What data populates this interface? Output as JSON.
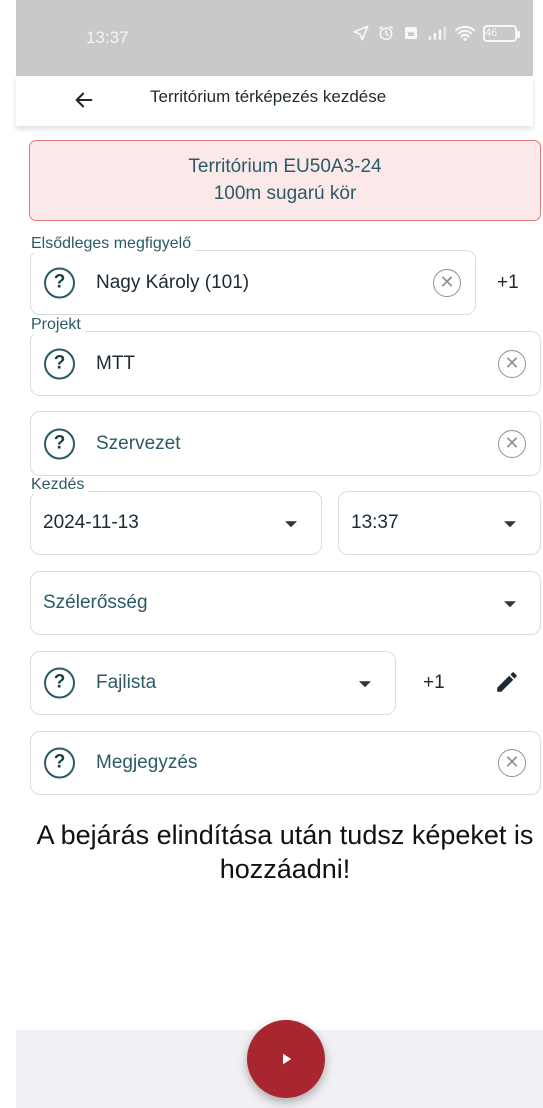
{
  "status_bar": {
    "time": "13:37",
    "battery": "46",
    "icons": [
      "location-arrow-icon",
      "alarm-icon",
      "sim-icon",
      "signal-icon",
      "wifi-icon",
      "battery-icon"
    ]
  },
  "app_bar": {
    "title": "Territórium térképezés kezdése",
    "back_icon": "arrow-left-icon"
  },
  "alert": {
    "line1": "Territórium EU50A3-24",
    "line2": "100m sugarú kör",
    "background": "#fbe9e9",
    "border": "#e07a7a"
  },
  "form": {
    "observer": {
      "label": "Elsődleges megfigyelő",
      "value": "Nagy Károly (101)",
      "extra": "+1"
    },
    "project": {
      "label": "Projekt",
      "value": "MTT"
    },
    "organization": {
      "placeholder": "Szervezet"
    },
    "start": {
      "label": "Kezdés",
      "date": "2024-11-13",
      "time": "13:37"
    },
    "wind": {
      "placeholder": "Szélerősség"
    },
    "species_list": {
      "placeholder": "Fajlista",
      "extra": "+1"
    },
    "note": {
      "placeholder": "Megjegyzés"
    }
  },
  "info_text": "A bejárás elindítása után tudsz képeket is hozzáadni!",
  "fab": {
    "icon": "play-icon",
    "color": "#a8262f"
  }
}
